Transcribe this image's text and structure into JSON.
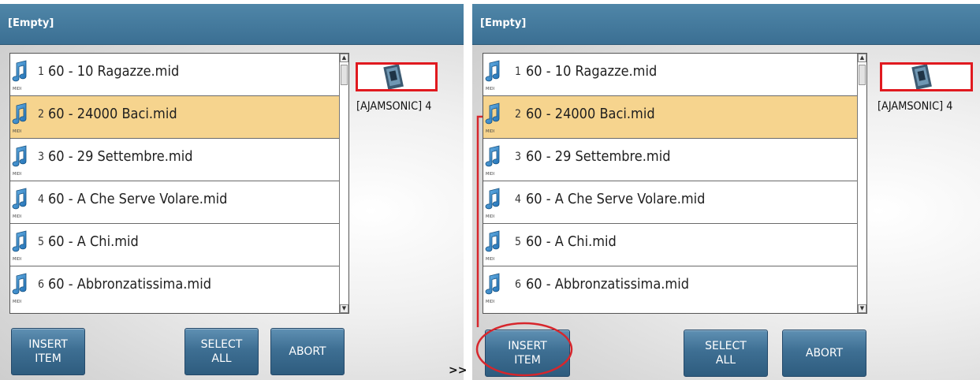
{
  "separator_label": ">>",
  "colors": {
    "header": "#3b6f93",
    "button": "#3e6f93",
    "selected_row": "#f6d48e",
    "highlight": "#e0191f"
  },
  "panels": [
    {
      "header_title": "[Empty]",
      "file_list": {
        "selected_index": 1,
        "items": [
          {
            "number": "1",
            "name": "60 - 10 Ragazze.mid",
            "type_label": "MIDI"
          },
          {
            "number": "2",
            "name": "60 - 24000 Baci.mid",
            "type_label": "MIDI"
          },
          {
            "number": "3",
            "name": "60 - 29 Settembre.mid",
            "type_label": "MIDI"
          },
          {
            "number": "4",
            "name": "60 - A Che Serve Volare.mid",
            "type_label": "MIDI"
          },
          {
            "number": "5",
            "name": "60 - A Chi.mid",
            "type_label": "MIDI"
          },
          {
            "number": "6",
            "name": "60 - Abbronzatissima.mid",
            "type_label": "MIDI"
          }
        ]
      },
      "device_label": "[AJAMSONIC] 4",
      "buttons": {
        "insert": "INSERT\nITEM",
        "select_all": "SELECT\nALL",
        "abort": "ABORT"
      }
    },
    {
      "header_title": "[Empty]",
      "file_list": {
        "selected_index": 1,
        "items": [
          {
            "number": "1",
            "name": "60 - 10 Ragazze.mid",
            "type_label": "MIDI"
          },
          {
            "number": "2",
            "name": "60 - 24000 Baci.mid",
            "type_label": "MIDI"
          },
          {
            "number": "3",
            "name": "60 - 29 Settembre.mid",
            "type_label": "MIDI"
          },
          {
            "number": "4",
            "name": "60 - A Che Serve Volare.mid",
            "type_label": "MIDI"
          },
          {
            "number": "5",
            "name": "60 - A Chi.mid",
            "type_label": "MIDI"
          },
          {
            "number": "6",
            "name": "60 - Abbronzatissima.mid",
            "type_label": "MIDI"
          }
        ]
      },
      "device_label": "[AJAMSONIC] 4",
      "buttons": {
        "insert": "INSERT\nITEM",
        "select_all": "SELECT\nALL",
        "abort": "ABORT"
      }
    }
  ]
}
